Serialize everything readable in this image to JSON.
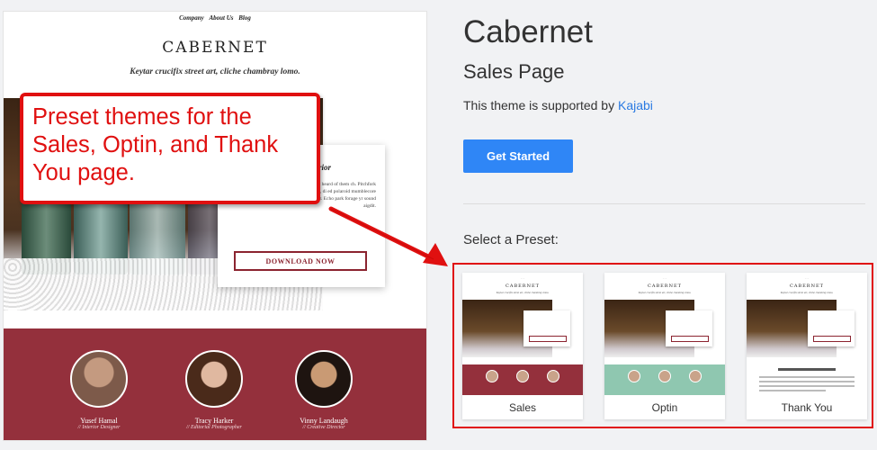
{
  "preview": {
    "nav": [
      "Company",
      "About Us",
      "Blog"
    ],
    "brand": "CABERNET",
    "tagline": "Keytar crucifix street art, cliche chambray lomo.",
    "card": {
      "heading_fragment": "rior",
      "body": "rch-key, sartorial before they sold sn't heard of them ch. Pitchfork Sustarian food truck butcher deep v bespoke, di ed polaroid mumblecore tattooed artisan. Food truck bitters kickstarter. Echo park forage yr sound aigdit.",
      "button": "DOWNLOAD NOW"
    },
    "team": [
      {
        "name": "Yusef Hamal",
        "role": "// Interior Designer"
      },
      {
        "name": "Tracy Harker",
        "role": "// Editorial Photographer"
      },
      {
        "name": "Vinny Landaugh",
        "role": "// Creative Director"
      }
    ]
  },
  "callout": {
    "text": "Preset themes for the Sales, Optin, and Thank You page.",
    "color": "#e01010"
  },
  "theme": {
    "title": "Cabernet",
    "subtitle": "Sales Page",
    "supported_prefix": "This theme is supported by ",
    "supported_link": "Kajabi",
    "cta": "Get Started",
    "select_label": "Select a Preset:",
    "presets": [
      "Sales",
      "Optin",
      "Thank You"
    ]
  },
  "colors": {
    "accent": "#2f86f6",
    "brand_red": "#94303c",
    "optin_green": "#8fc7b0"
  }
}
